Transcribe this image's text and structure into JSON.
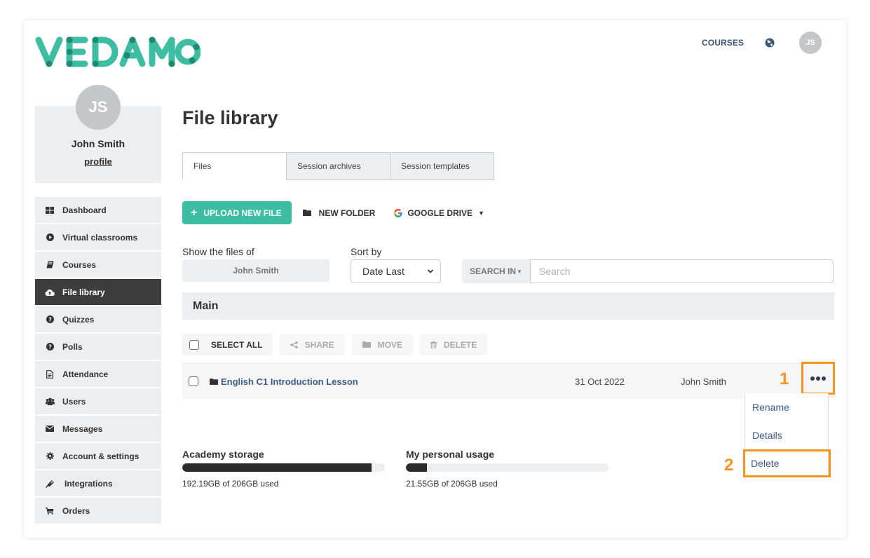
{
  "brand": {
    "name": "VEDAMO",
    "accent": "#3dbea3",
    "accent_dark": "#1f8a6e"
  },
  "top_nav": {
    "courses_label": "COURSES",
    "avatar_initials": "JS",
    "globe_icon": "globe-icon"
  },
  "profile": {
    "initials": "JS",
    "name": "John Smith",
    "link_label": "profile"
  },
  "sidebar": {
    "items": [
      {
        "label": "Dashboard",
        "icon": "grid-icon",
        "active": false
      },
      {
        "label": "Virtual classrooms",
        "icon": "play-circle-icon",
        "active": false
      },
      {
        "label": "Courses",
        "icon": "book-icon",
        "active": false
      },
      {
        "label": "File library",
        "icon": "cloud-upload-icon",
        "active": true
      },
      {
        "label": "Quizzes",
        "icon": "question-circle-icon",
        "active": false
      },
      {
        "label": "Polls",
        "icon": "question-circle-icon",
        "active": false
      },
      {
        "label": "Attendance",
        "icon": "document-icon",
        "active": false
      },
      {
        "label": "Users",
        "icon": "users-icon",
        "active": false
      },
      {
        "label": "Messages",
        "icon": "envelope-icon",
        "active": false
      },
      {
        "label": "Account & settings",
        "icon": "gear-icon",
        "active": false
      },
      {
        "label": "Integrations",
        "icon": "plug-icon",
        "active": false
      },
      {
        "label": "Orders",
        "icon": "cart-icon",
        "active": false
      }
    ]
  },
  "main": {
    "title": "File library",
    "tabs": [
      {
        "label": "Files",
        "active": true
      },
      {
        "label": "Session archives",
        "active": false
      },
      {
        "label": "Session templates",
        "active": false
      }
    ],
    "actions": {
      "upload_label": "UPLOAD NEW FILE",
      "new_folder_label": "NEW FOLDER",
      "google_drive_label": "GOOGLE DRIVE"
    },
    "filters": {
      "show_files_of_label": "Show the files of",
      "show_files_of_value": "John Smith",
      "sort_by_label": "Sort by",
      "sort_by_value": "Date Last",
      "search_in_label": "SEARCH IN",
      "search_placeholder": "Search",
      "search_value": ""
    },
    "folder_header": "Main",
    "bulk": {
      "select_all_label": "SELECT ALL",
      "share_label": "SHARE",
      "move_label": "MOVE",
      "delete_label": "DELETE"
    },
    "files": [
      {
        "name": "English C1 Introduction Lesson",
        "type": "folder",
        "date": "31 Oct 2022",
        "owner": "John Smith"
      }
    ],
    "context_menu": {
      "items": [
        {
          "label": "Rename",
          "highlighted": false
        },
        {
          "label": "Details",
          "highlighted": false
        },
        {
          "label": "Delete",
          "highlighted": true
        }
      ]
    },
    "annotations": {
      "step1": "1",
      "step2": "2",
      "color": "#f7931e"
    },
    "storage": {
      "academy": {
        "title": "Academy storage",
        "used_gb": 192.19,
        "total_gb": 206,
        "fraction": 0.933,
        "text": "192.19GB of 206GB used"
      },
      "personal": {
        "title": "My personal usage",
        "used_gb": 21.55,
        "total_gb": 206,
        "fraction": 0.105,
        "text": "21.55GB of 206GB used"
      }
    }
  }
}
